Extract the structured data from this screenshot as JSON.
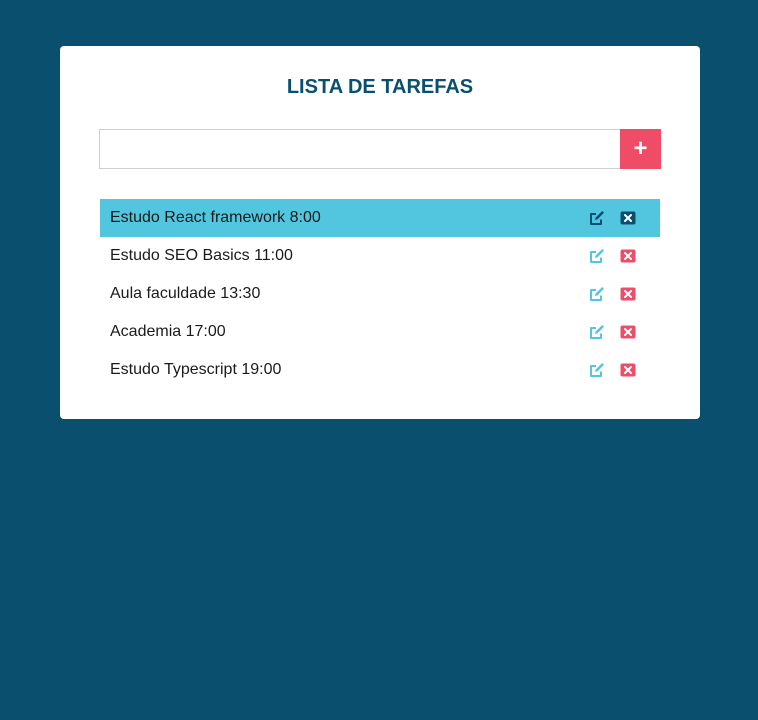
{
  "app": {
    "title": "LISTA DE TAREFAS"
  },
  "new_task": {
    "value": "",
    "placeholder": "",
    "add_label": "+"
  },
  "tasks": [
    {
      "label": "Estudo React framework 8:00",
      "selected": true
    },
    {
      "label": "Estudo SEO Basics 11:00",
      "selected": false
    },
    {
      "label": "Aula faculdade 13:30",
      "selected": false
    },
    {
      "label": "Academia 17:00",
      "selected": false
    },
    {
      "label": "Estudo Typescript 19:00",
      "selected": false
    }
  ],
  "icons": {
    "edit": "edit-icon",
    "delete": "delete-icon"
  },
  "colors": {
    "background": "#0a4f6e",
    "card": "#ffffff",
    "accent_add": "#ef4c68",
    "selected_row": "#52c6de",
    "edit_icon": "#52c6de",
    "delete_icon": "#ef4c68",
    "selected_icon": "#0a4f6e"
  }
}
